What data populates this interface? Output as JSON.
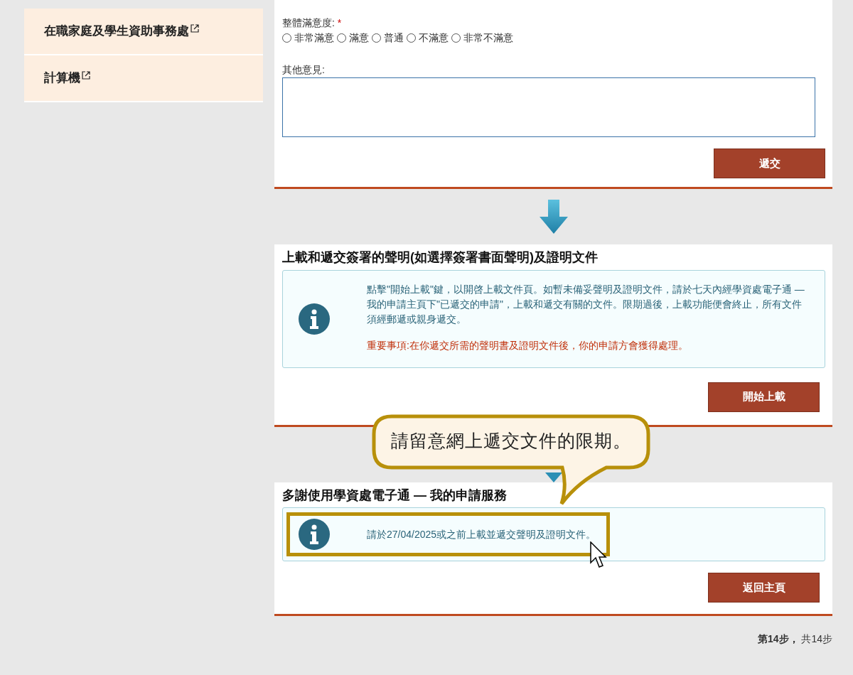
{
  "sidebar": {
    "items": [
      {
        "label": "在職家庭及學生資助事務處",
        "external": true
      },
      {
        "label": "計算機",
        "external": true
      }
    ]
  },
  "survey": {
    "rating_label": "整體滿意度:",
    "required_mark": "*",
    "options": [
      {
        "label": "非常滿意",
        "selected": false
      },
      {
        "label": "滿意",
        "selected": false
      },
      {
        "label": "普通",
        "selected": false
      },
      {
        "label": "不滿意",
        "selected": false
      },
      {
        "label": "非常不滿意",
        "selected": false
      }
    ],
    "comment_label": "其他意見:",
    "submit": "遞交"
  },
  "upload": {
    "title": "上載和遞交簽署的聲明(如選擇簽署書面聲明)及證明文件",
    "info": "點擊\"開始上載\"鍵，以開啓上載文件頁。如暫未備妥聲明及證明文件，請於七天內經學資處電子通 — 我的申請主頁下\"已遞交的申請\"，上載和遞交有關的文件。限期過後，上載功能便會終止，所有文件須經郵遞或親身遞交。",
    "important": "重要事項:在你遞交所需的聲明書及證明文件後，你的申請方會獲得處理。",
    "button": "開始上載"
  },
  "thanks": {
    "title": "多謝使用學資處電子通 — 我的申請服務",
    "info": "請於27/04/2025或之前上載並遞交聲明及證明文件。",
    "button": "返回主頁"
  },
  "step": "**第14步，** 共14步",
  "callout": {
    "text": "請留意網上遞交文件的限期。"
  }
}
